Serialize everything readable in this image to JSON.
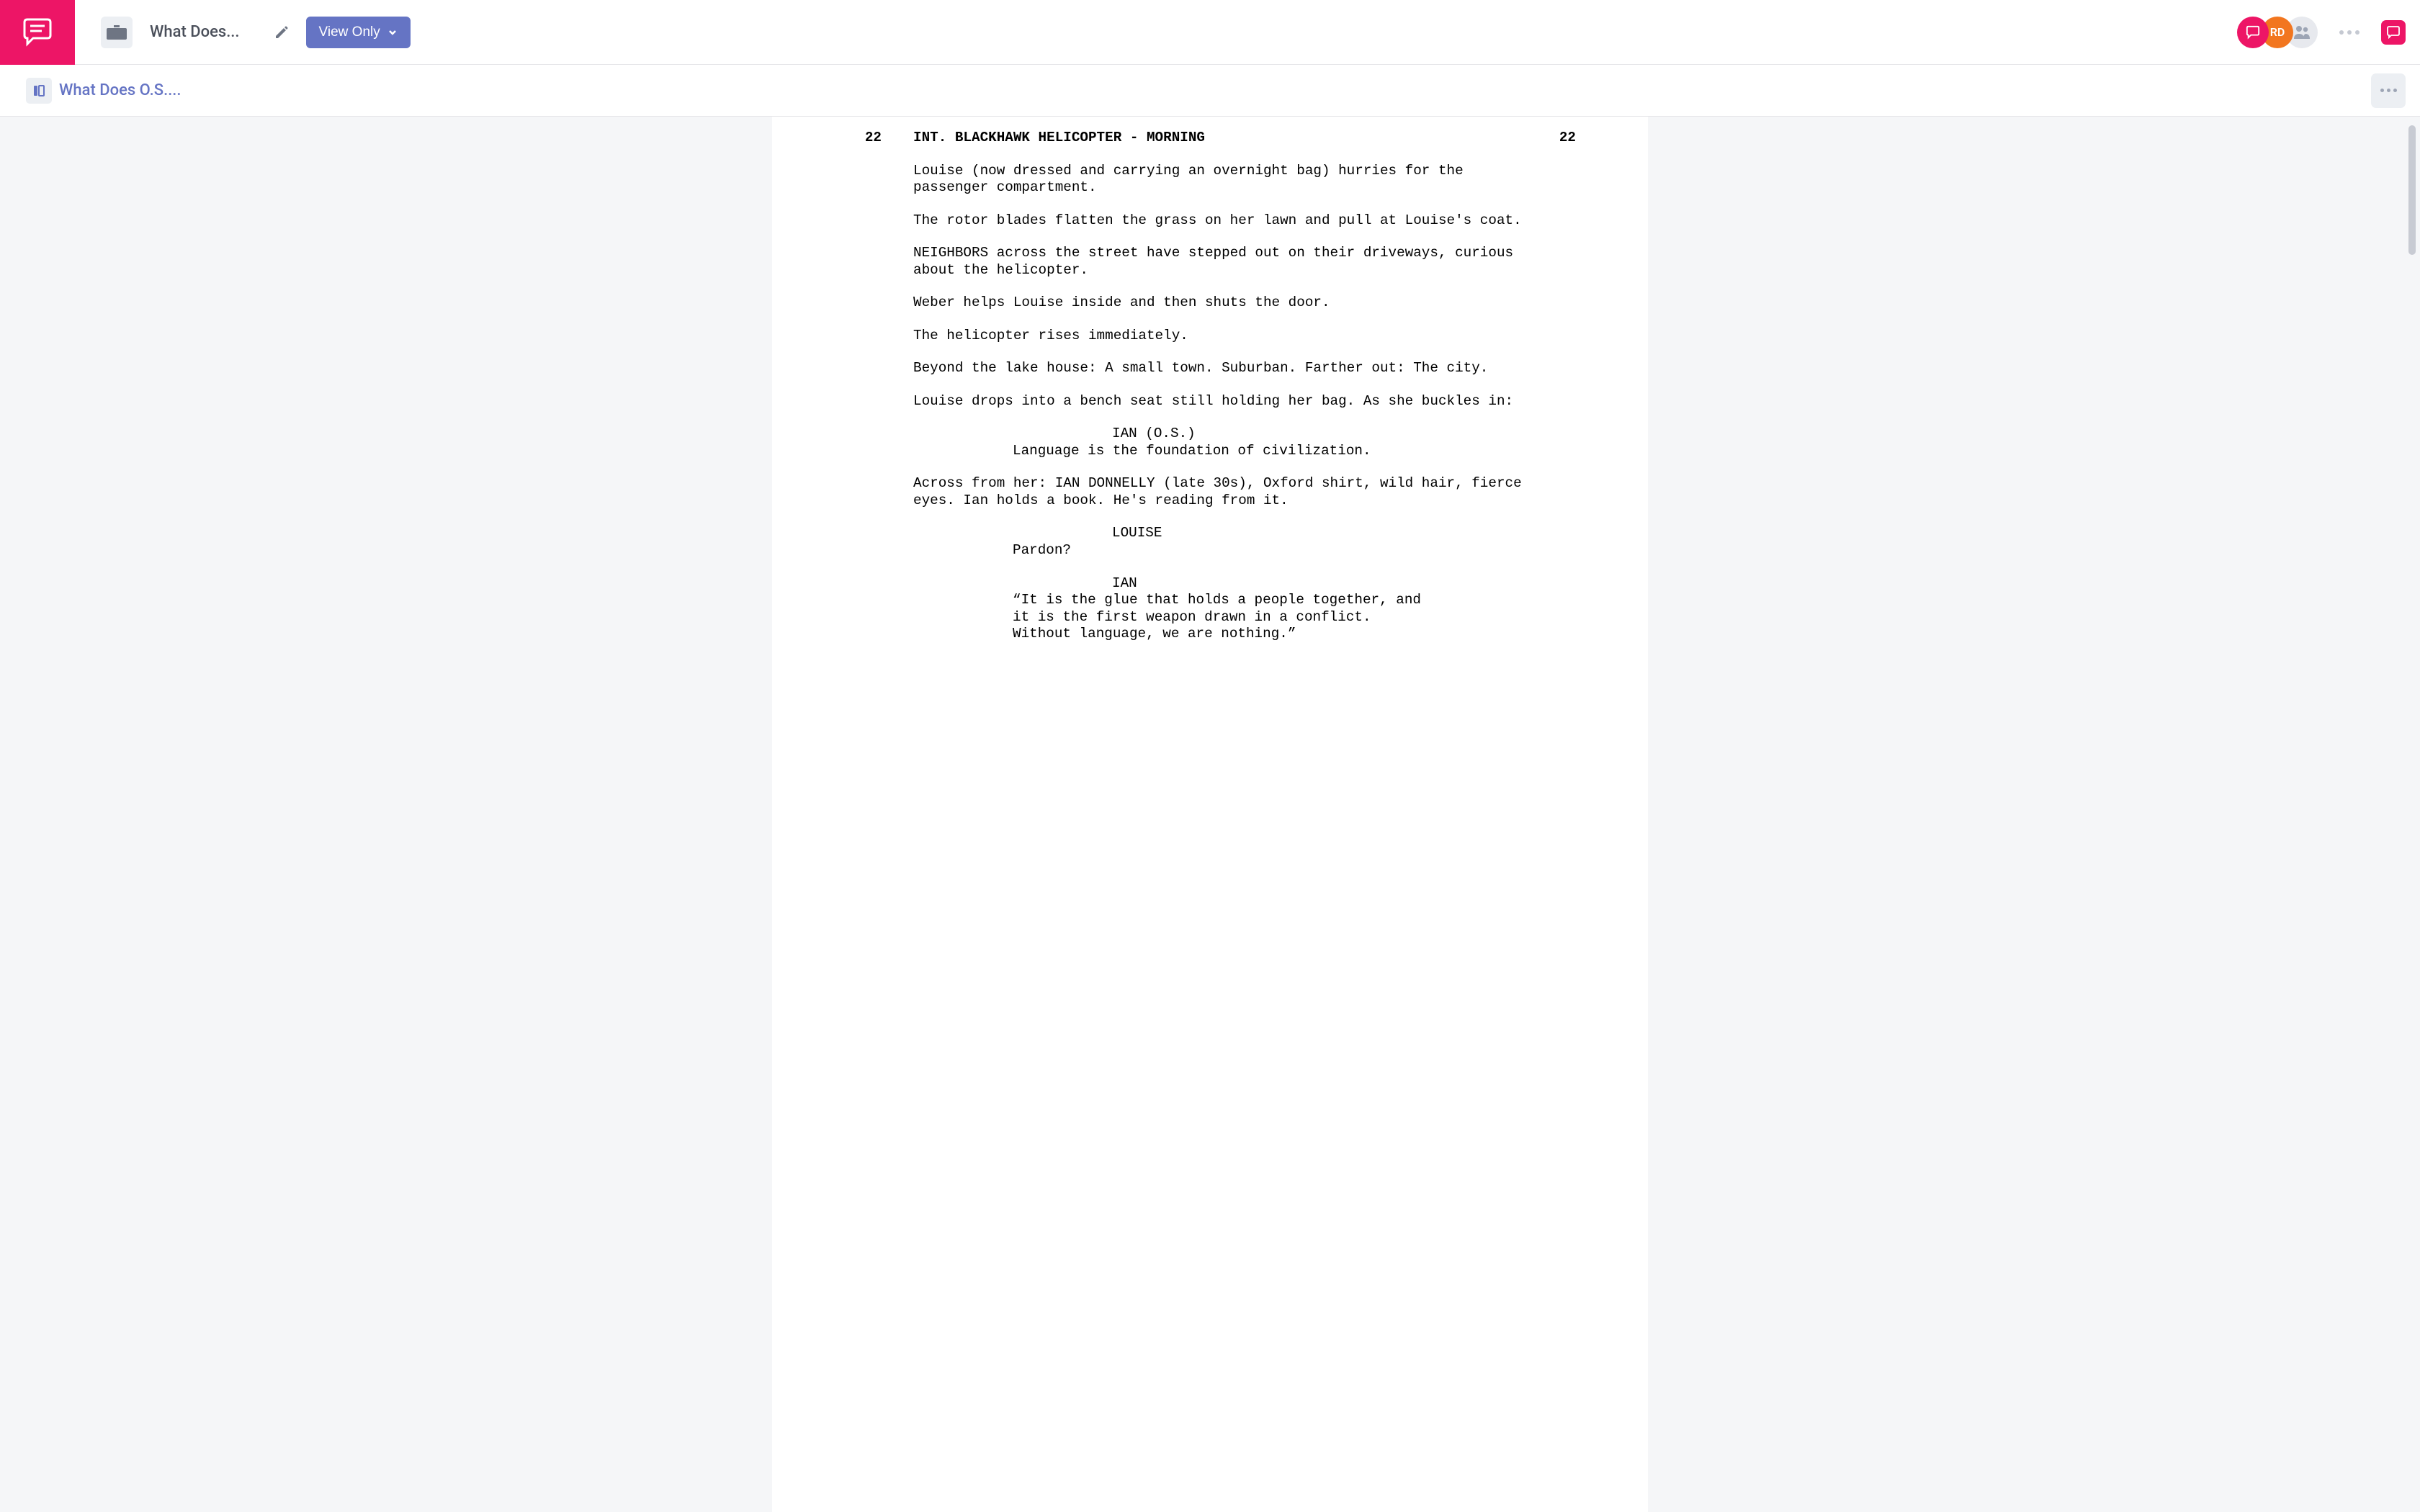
{
  "header": {
    "file_title": "What Does...",
    "view_button": "View Only",
    "avatar2_initials": "RD"
  },
  "subbar": {
    "doc_title": "What Does O.S...."
  },
  "screenplay": {
    "scene_number": "22",
    "scene_heading": "INT. BLACKHAWK HELICOPTER - MORNING",
    "actions": [
      "Louise (now dressed and carrying an overnight bag) hurries for the passenger compartment.",
      "The rotor blades flatten the grass on her lawn and pull at Louise's coat.",
      "NEIGHBORS across the street have stepped out on their driveways, curious about the helicopter.",
      "Weber helps Louise inside and then shuts the door.",
      "The helicopter rises immediately.",
      "Beyond the lake house: A small town. Suburban. Farther out: The city.",
      "Louise drops into a bench seat still holding her bag. As she buckles in:"
    ],
    "dialogue1": {
      "character": "IAN (O.S.)",
      "line": "Language is the foundation of civilization."
    },
    "action8": "Across from her: IAN DONNELLY (late 30s), Oxford shirt, wild hair, fierce eyes. Ian holds a book. He's reading from it.",
    "dialogue2": {
      "character": "LOUISE",
      "line": "Pardon?"
    },
    "dialogue3": {
      "character": "IAN",
      "line": "“It is the glue that holds a people together, and it is the first weapon drawn in a conflict. Without language, we are nothing.”"
    }
  }
}
